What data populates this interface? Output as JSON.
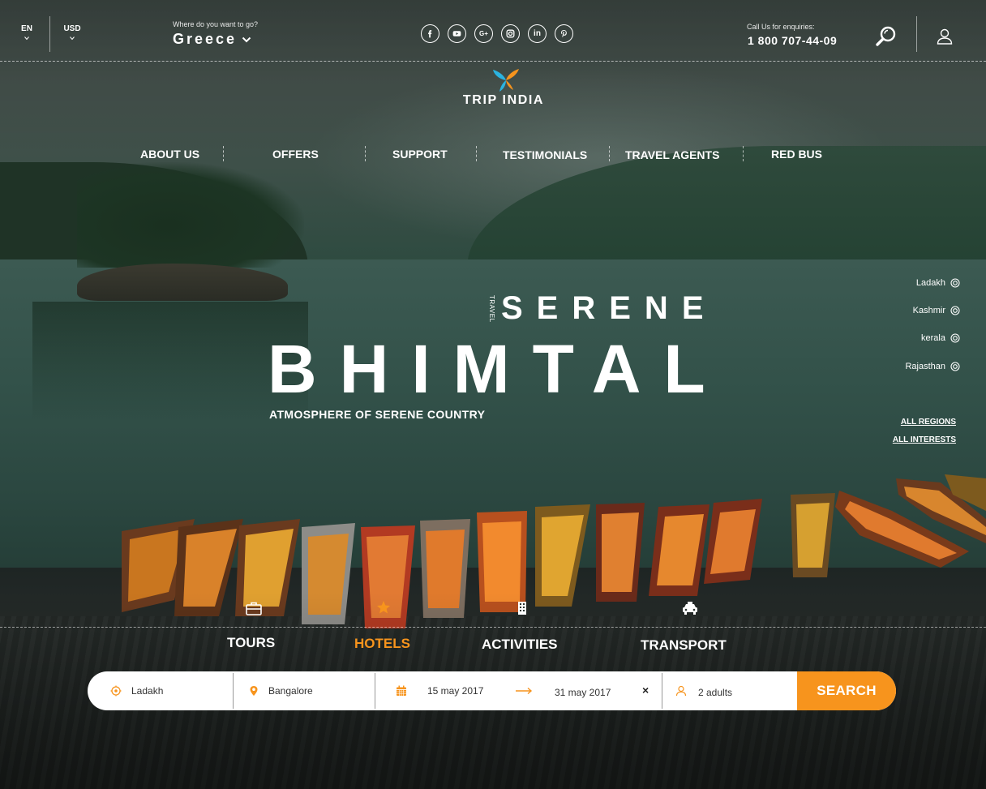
{
  "topbar": {
    "language": "EN",
    "currency": "USD",
    "destination_label": "Where do you want to go?",
    "destination_value": "Greece",
    "socials": [
      "facebook-icon",
      "youtube-icon",
      "google-plus-icon",
      "instagram-icon",
      "linkedin-icon",
      "pinterest-icon"
    ],
    "call_label": "Call Us for enquiries:",
    "phone": "1 800 707-44-09"
  },
  "logo": {
    "text": "TRIP INDIA"
  },
  "nav": {
    "items": [
      {
        "label": "ABOUT US"
      },
      {
        "label": "OFFERS"
      },
      {
        "label": "SUPPORT"
      },
      {
        "label": "TESTIMONIALS"
      },
      {
        "label": "TRAVEL AGENTS"
      },
      {
        "label": "RED BUS"
      }
    ]
  },
  "hero": {
    "tag": "TRAVEL",
    "line1": "SERENE",
    "line2": "BHIMTAL",
    "subtitle": "ATMOSPHERE OF SERENE COUNTRY"
  },
  "regions": {
    "items": [
      {
        "label": "Ladakh"
      },
      {
        "label": "Kashmir"
      },
      {
        "label": "kerala"
      },
      {
        "label": "Rajasthan"
      }
    ],
    "all_regions": "ALL REGIONS",
    "all_interests": "ALL INTERESTS"
  },
  "tabs": {
    "items": [
      {
        "label": "TOURS",
        "icon": "suitcase-icon"
      },
      {
        "label": "HOTELS",
        "icon": "star-icon"
      },
      {
        "label": "ACTIVITIES",
        "icon": "building-icon"
      },
      {
        "label": "TRANSPORT",
        "icon": "taxi-icon"
      }
    ],
    "active": "HOTELS"
  },
  "search": {
    "from": "Ladakh",
    "to": "Bangalore",
    "date_from": "15 may 2017",
    "date_to": "31 may 2017",
    "clear": "×",
    "guests": "2 adults",
    "button": "SEARCH"
  },
  "colors": {
    "accent": "#f7941d",
    "logo_orange": "#f7941d",
    "logo_blue": "#2bb3e0"
  }
}
